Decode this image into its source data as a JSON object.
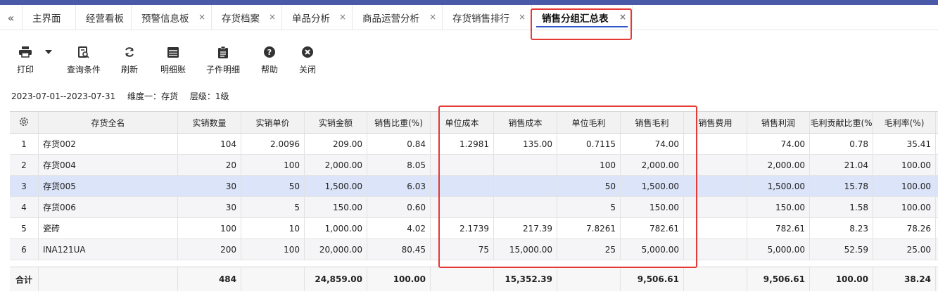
{
  "tabs": {
    "back_icon": "double-chevron-left",
    "items": [
      {
        "label": "主界面",
        "closable": false
      },
      {
        "label": "经营看板",
        "closable": false
      },
      {
        "label": "预警信息板",
        "closable": true
      },
      {
        "label": "存货档案",
        "closable": true
      },
      {
        "label": "单品分析",
        "closable": true
      },
      {
        "label": "商品运营分析",
        "closable": true
      },
      {
        "label": "存货销售排行",
        "closable": true
      },
      {
        "label": "销售分组汇总表",
        "closable": true,
        "active": true
      }
    ],
    "close_glyph": "×"
  },
  "toolbar": {
    "print": "打印",
    "query": "查询条件",
    "refresh": "刷新",
    "detail_ledger": "明细账",
    "child_detail": "子件明细",
    "help": "帮助",
    "close": "关闭"
  },
  "filter": {
    "date_range": "2023-07-01--2023-07-31",
    "dimension": "维度一：存货",
    "level": "层级：1级"
  },
  "table": {
    "columns": [
      "",
      "存货全名",
      "实销数量",
      "实销单价",
      "实销金额",
      "销售比重(%)",
      "单位成本",
      "销售成本",
      "单位毛利",
      "销售毛利",
      "销售费用",
      "销售利润",
      "毛利贡献比重(%",
      "毛利率(%)"
    ],
    "rows": [
      [
        "1",
        "存货002",
        "104",
        "2.0096",
        "209.00",
        "0.84",
        "1.2981",
        "135.00",
        "0.7115",
        "74.00",
        "",
        "74.00",
        "0.78",
        "35.41"
      ],
      [
        "2",
        "存货004",
        "20",
        "100",
        "2,000.00",
        "8.05",
        "",
        "",
        "100",
        "2,000.00",
        "",
        "2,000.00",
        "21.04",
        "100.00"
      ],
      [
        "3",
        "存货005",
        "30",
        "50",
        "1,500.00",
        "6.03",
        "",
        "",
        "50",
        "1,500.00",
        "",
        "1,500.00",
        "15.78",
        "100.00"
      ],
      [
        "4",
        "存货006",
        "30",
        "5",
        "150.00",
        "0.60",
        "",
        "",
        "5",
        "150.00",
        "",
        "150.00",
        "1.58",
        "100.00"
      ],
      [
        "5",
        "瓷砖",
        "100",
        "10",
        "1,000.00",
        "4.02",
        "2.1739",
        "217.39",
        "7.8261",
        "782.61",
        "",
        "782.61",
        "8.23",
        "78.26"
      ],
      [
        "6",
        "INA121UA",
        "200",
        "100",
        "20,000.00",
        "80.45",
        "75",
        "15,000.00",
        "25",
        "5,000.00",
        "",
        "5,000.00",
        "52.59",
        "25.00"
      ]
    ],
    "selected_row": 3,
    "total": [
      "合计",
      "",
      "484",
      "",
      "24,859.00",
      "100.00",
      "",
      "15,352.39",
      "",
      "9,506.61",
      "",
      "9,506.61",
      "100.00",
      "38.24"
    ]
  },
  "colors": {
    "accent": "#2f55c9",
    "highlight_box": "#e53935",
    "selected_row": "#dbe4f8",
    "top_bar": "#4a5aa8"
  }
}
